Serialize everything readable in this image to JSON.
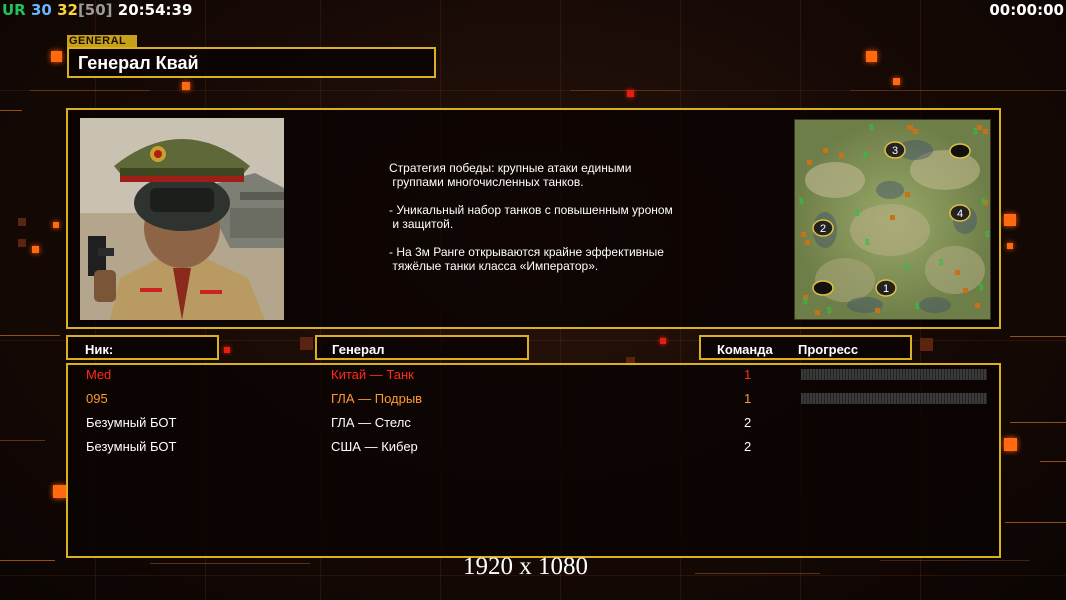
{
  "hud": {
    "ur": "UR",
    "v1": "30",
    "v2": "32",
    "v3": "[50]",
    "clock": "20:54:39",
    "timer": "00:00:00"
  },
  "general_tag": "GENERAL",
  "general_name": "Генерал Квай",
  "description": {
    "p1": "Стратегия победы: крупные атаки едиными\n группами многочисленных танков.",
    "p2": "- Уникальный набор танков с повышенным уроном\n и защитой.",
    "p3": "- На 3м Ранге открываются крайне эффективные\n тяжёлые танки класса «Император»."
  },
  "map": {
    "spots": [
      "1",
      "2",
      "3",
      "4"
    ]
  },
  "headers": {
    "nick": "Ник:",
    "general": "Генерал",
    "team": "Команда",
    "progress": "Прогресс"
  },
  "players": [
    {
      "nick": "Med",
      "general": "Китай — Танк",
      "team": "1",
      "color": "#ff2a1a",
      "has_progress": true
    },
    {
      "nick": "095",
      "general": "ГЛА — Подрыв",
      "team": "1",
      "color": "#ff9a2a",
      "has_progress": true
    },
    {
      "nick": "Безумный БОТ",
      "general": "ГЛА — Стелс",
      "team": "2",
      "color": "#ffffff",
      "has_progress": false
    },
    {
      "nick": "Безумный БОТ",
      "general": "США — Кибер",
      "team": "2",
      "color": "#ffffff",
      "has_progress": false
    }
  ],
  "resolution": "1920 x 1080",
  "colors": {
    "frame": "#d9b020",
    "accent": "#ff6a10"
  }
}
